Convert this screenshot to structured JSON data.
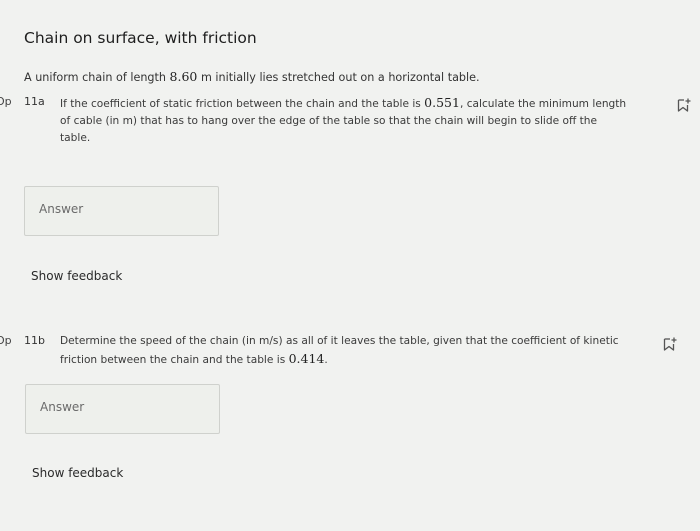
{
  "page": {
    "title": "Chain on surface, with friction",
    "intro_prefix": "A uniform chain of length ",
    "intro_value": "8.60",
    "intro_suffix": " m initially lies stretched out on a horizontal table."
  },
  "questions": [
    {
      "side_tag": "Op",
      "number": "11a",
      "line1_prefix": "If the coefficient of static friction between the chain and the table is ",
      "line1_value": "0.551",
      "line1_suffix": ", calculate the minimum length",
      "line2": "of cable (in m) that has to hang over the edge of the table so that the chain will begin to slide off the",
      "line3": "table.",
      "answer_placeholder": "Answer",
      "feedback_label": "Show feedback",
      "bookmark_icon": "bookmark-add-icon"
    },
    {
      "side_tag": "Op",
      "number": "11b",
      "line1": "Determine the speed of the chain (in m/s) as all of it leaves the table, given that the coefficient of kinetic",
      "line2_prefix": "friction between the chain and the table is ",
      "line2_value": "0.414",
      "line2_suffix": ".",
      "answer_placeholder": "Answer",
      "feedback_label": "Show feedback",
      "bookmark_icon": "bookmark-add-icon"
    }
  ]
}
